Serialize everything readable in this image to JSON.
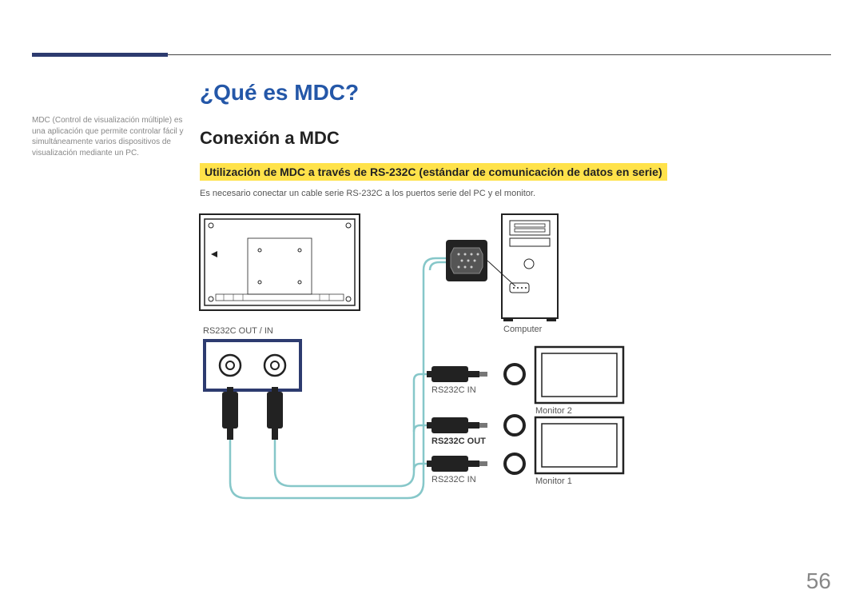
{
  "sidebar": {
    "text": "MDC (Control de visualización múltiple) es una aplicación que permite controlar fácil y simultáneamente varios dispositivos de visualización mediante un PC."
  },
  "title": "¿Qué es MDC?",
  "subtitle": "Conexión a MDC",
  "highlight": "Utilización de MDC a través de RS-232C (estándar de comunicación de datos en serie)",
  "description": "Es necesario conectar un cable serie RS-232C a los puertos serie del PC y el monitor.",
  "labels": {
    "ports": "RS232C OUT / IN",
    "computer": "Computer",
    "rs_in_top": "RS232C IN",
    "rs_out": "RS232C OUT",
    "rs_in_bottom": "RS232C IN",
    "monitor1": "Monitor 1",
    "monitor2": "Monitor 2"
  },
  "page_number": "56"
}
